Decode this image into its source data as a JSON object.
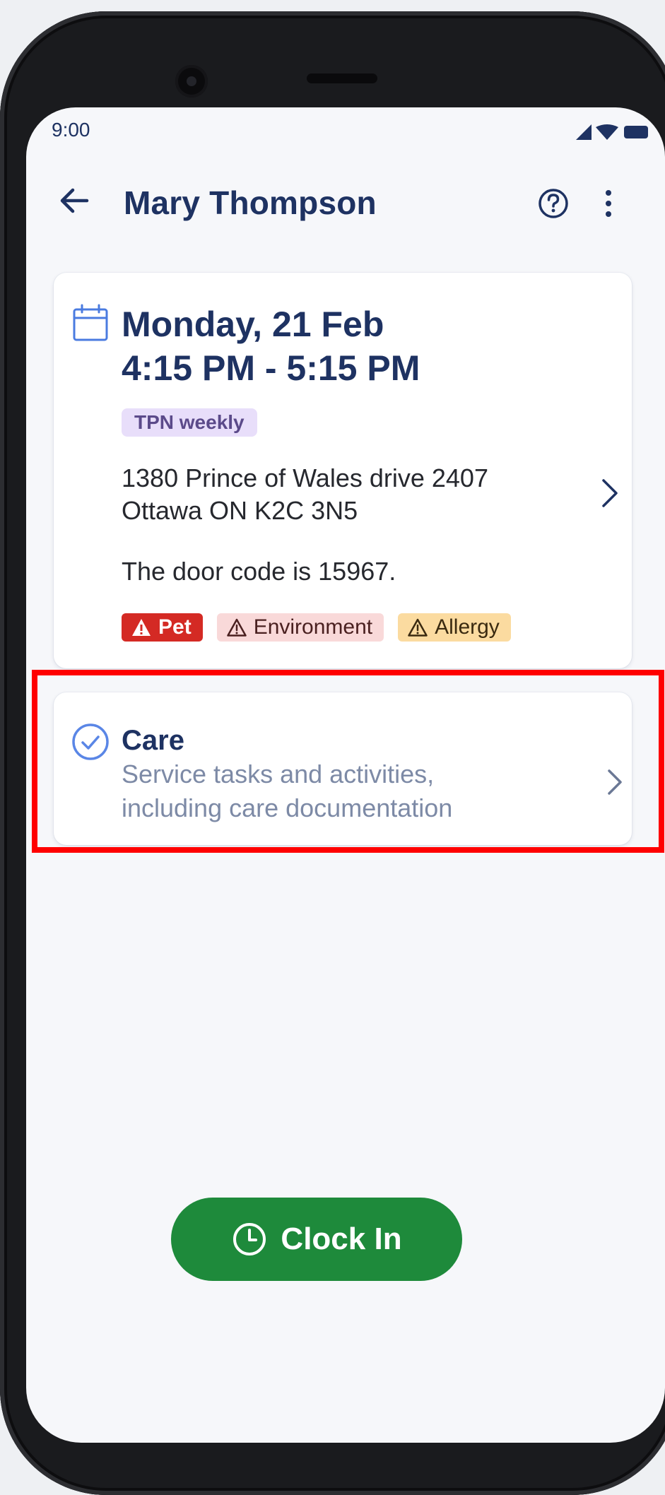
{
  "status_bar": {
    "time": "9:00"
  },
  "header": {
    "title": "Mary Thompson",
    "back_icon": "arrow-left-icon",
    "help_icon": "help-circle-icon",
    "more_icon": "more-vertical-icon"
  },
  "visit": {
    "date": "Monday, 21 Feb",
    "time_range": "4:15 PM - 5:15 PM",
    "tag": "TPN weekly",
    "address_line1": "1380 Prince of Wales drive 2407",
    "address_line2": "Ottawa ON K2C 3N5",
    "note": "The door code is 15967.",
    "alerts": [
      {
        "label": "Pet",
        "color": "#d42a24"
      },
      {
        "label": "Environment",
        "color": "#f9d9d9"
      },
      {
        "label": "Allergy",
        "color": "#fbdba0"
      }
    ]
  },
  "care": {
    "title": "Care",
    "description_line1": "Service tasks and activities,",
    "description_line2": "including care documentation"
  },
  "actions": {
    "clock_in_label": "Clock In"
  },
  "colors": {
    "primary_navy": "#1e3262",
    "clock_in_green": "#1e8a3b",
    "highlight": "#ff0000"
  }
}
